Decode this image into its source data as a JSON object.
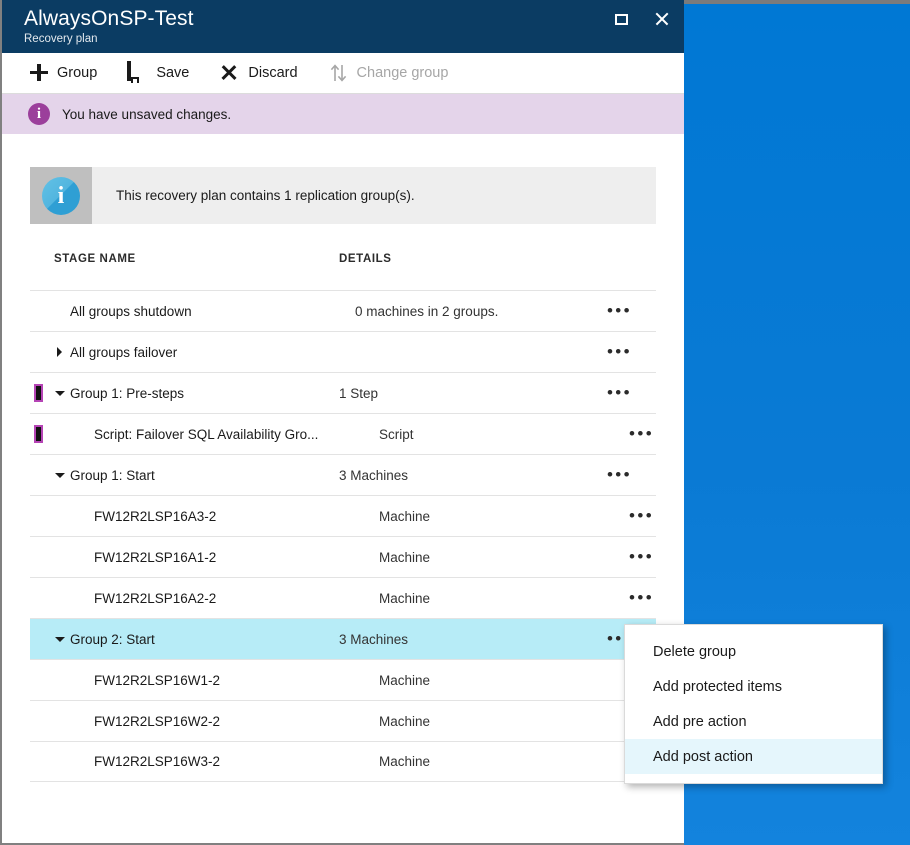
{
  "window": {
    "title": "AlwaysOnSP-Test",
    "subtitle": "Recovery plan",
    "controls": {
      "restore": "restore-window",
      "close": "close-window"
    }
  },
  "toolbar": {
    "items": [
      {
        "label": "Group",
        "icon": "plus-icon",
        "disabled": false
      },
      {
        "label": "Save",
        "icon": "save-icon",
        "disabled": false
      },
      {
        "label": "Discard",
        "icon": "close-x-icon",
        "disabled": false
      },
      {
        "label": "Change group",
        "icon": "swap-arrows-icon",
        "disabled": true
      }
    ]
  },
  "banner": {
    "icon": "info-circle-icon",
    "text": "You have unsaved changes.",
    "background": "#e4d4ea",
    "icon_color": "#9b3f9b"
  },
  "info_box": {
    "icon": "info-circle-icon",
    "text": "This recovery plan contains 1 replication group(s).",
    "icon_color": "#3ea8dc"
  },
  "table": {
    "headers": {
      "stage_name": "STAGE NAME",
      "details": "DETAILS"
    },
    "overflow_glyph": "•••",
    "rows": [
      {
        "stage": "All groups shutdown",
        "details": "0 machines in 2 groups.",
        "indent": 1,
        "caret": "none",
        "marker": false,
        "selected": false
      },
      {
        "stage": "All groups failover",
        "details": "",
        "indent": 0,
        "caret": "right",
        "marker": false,
        "selected": false
      },
      {
        "stage": "Group 1: Pre-steps",
        "details": "1 Step",
        "indent": 0,
        "caret": "down",
        "marker": true,
        "selected": false
      },
      {
        "stage": "Script: Failover SQL Availability Gro...",
        "details": "Script",
        "indent": 2,
        "caret": "none",
        "marker": true,
        "selected": false
      },
      {
        "stage": "Group 1: Start",
        "details": "3 Machines",
        "indent": 0,
        "caret": "down",
        "marker": false,
        "selected": false
      },
      {
        "stage": "FW12R2LSP16A3-2",
        "details": "Machine",
        "indent": 2,
        "caret": "none",
        "marker": false,
        "selected": false
      },
      {
        "stage": "FW12R2LSP16A1-2",
        "details": "Machine",
        "indent": 2,
        "caret": "none",
        "marker": false,
        "selected": false
      },
      {
        "stage": "FW12R2LSP16A2-2",
        "details": "Machine",
        "indent": 2,
        "caret": "none",
        "marker": false,
        "selected": false
      },
      {
        "stage": "Group 2: Start",
        "details": "3 Machines",
        "indent": 0,
        "caret": "down",
        "marker": false,
        "selected": true
      },
      {
        "stage": "FW12R2LSP16W1-2",
        "details": "Machine",
        "indent": 2,
        "caret": "none",
        "marker": false,
        "selected": false
      },
      {
        "stage": "FW12R2LSP16W2-2",
        "details": "Machine",
        "indent": 2,
        "caret": "none",
        "marker": false,
        "selected": false
      },
      {
        "stage": "FW12R2LSP16W3-2",
        "details": "Machine",
        "indent": 2,
        "caret": "none",
        "marker": false,
        "selected": false
      }
    ]
  },
  "context_menu": {
    "items": [
      {
        "label": "Delete group",
        "highlighted": false
      },
      {
        "label": "Add protected items",
        "highlighted": false
      },
      {
        "label": "Add pre action",
        "highlighted": false
      },
      {
        "label": "Add post action",
        "highlighted": true
      }
    ]
  },
  "colors": {
    "titlebar": "#0b3c63",
    "desktop": "#0a7ad4",
    "selected_row": "#b7ecf7",
    "menu_highlight": "#e5f6fc",
    "marker": "#b544b5"
  }
}
